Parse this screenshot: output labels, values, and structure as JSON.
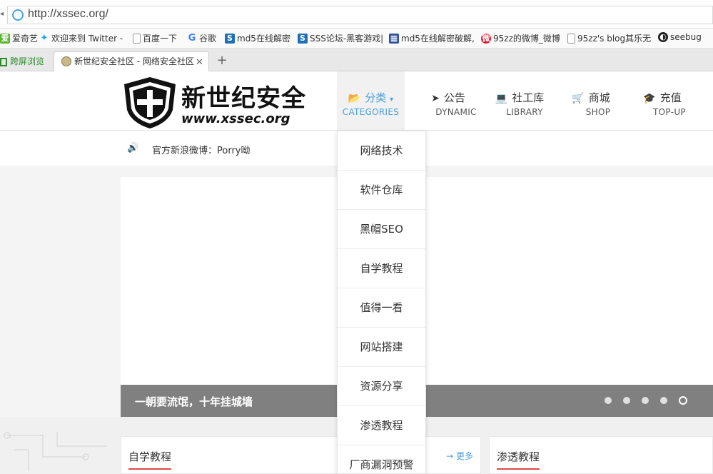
{
  "browser": {
    "url": "http://xssec.org/",
    "bookmarks": [
      {
        "label": "爱奇艺",
        "icon": "iqiyi-icon",
        "color": "#5cb531"
      },
      {
        "label": "欢迎来到 Twitter -",
        "icon": "twitter-icon",
        "color": "#1da1f2"
      },
      {
        "label": "百度一下",
        "icon": "page-icon",
        "color": "#999999"
      },
      {
        "label": "谷歌",
        "icon": "google-icon",
        "color": "#4285f4"
      },
      {
        "label": "md5在线解密",
        "icon": "s-icon",
        "color": "#1e6fb8"
      },
      {
        "label": "SSS论坛-黑客游戏|",
        "icon": "s-icon",
        "color": "#1e6fb8"
      },
      {
        "label": "md5在线解密破解,",
        "icon": "grid-icon",
        "color": "#2f4f9f"
      },
      {
        "label": "95zz的微博_微博",
        "icon": "weibo-icon",
        "color": "#e6162d"
      },
      {
        "label": "95zz's blog其乐无",
        "icon": "page-icon",
        "color": "#999999"
      },
      {
        "label": "seebug",
        "icon": "seebug-icon",
        "color": "#222222"
      }
    ],
    "tabs": [
      {
        "label": "跨屏浏览"
      },
      {
        "label": "新世纪安全社区 - 网络安全社区"
      }
    ]
  },
  "site": {
    "logo": {
      "line1": "新世纪安全",
      "line2": "www.xssec.org"
    },
    "nav": [
      {
        "cn": "分类",
        "en": "CATEGORIES",
        "icon": "folder-open-icon",
        "active": true
      },
      {
        "cn": "公告",
        "en": "DYNAMIC",
        "icon": "paper-plane-icon",
        "active": false
      },
      {
        "cn": "社工库",
        "en": "LIBRARY",
        "icon": "laptop-icon",
        "active": false
      },
      {
        "cn": "商城",
        "en": "SHOP",
        "icon": "cart-icon",
        "active": false
      },
      {
        "cn": "充值",
        "en": "TOP-UP",
        "icon": "graduation-cap-icon",
        "active": false
      }
    ],
    "notice": "官方新浪微博：Porry呦",
    "banner": {
      "caption": "一朝要流氓，十年挂城墙",
      "slide_count": 5,
      "current_slide": 5
    },
    "sections": [
      {
        "title": "自学教程",
        "more": "→ 更多"
      },
      {
        "title": "渗透教程"
      }
    ],
    "dropdown": [
      "网络技术",
      "软件仓库",
      "黑帽SEO",
      "自学教程",
      "值得一看",
      "网站搭建",
      "资源分享",
      "渗透教程",
      "厂商漏洞预警"
    ]
  },
  "colors": {
    "accent": "#4a9ee0",
    "section_underline": "#e04848",
    "caption_bg": "#808080"
  }
}
